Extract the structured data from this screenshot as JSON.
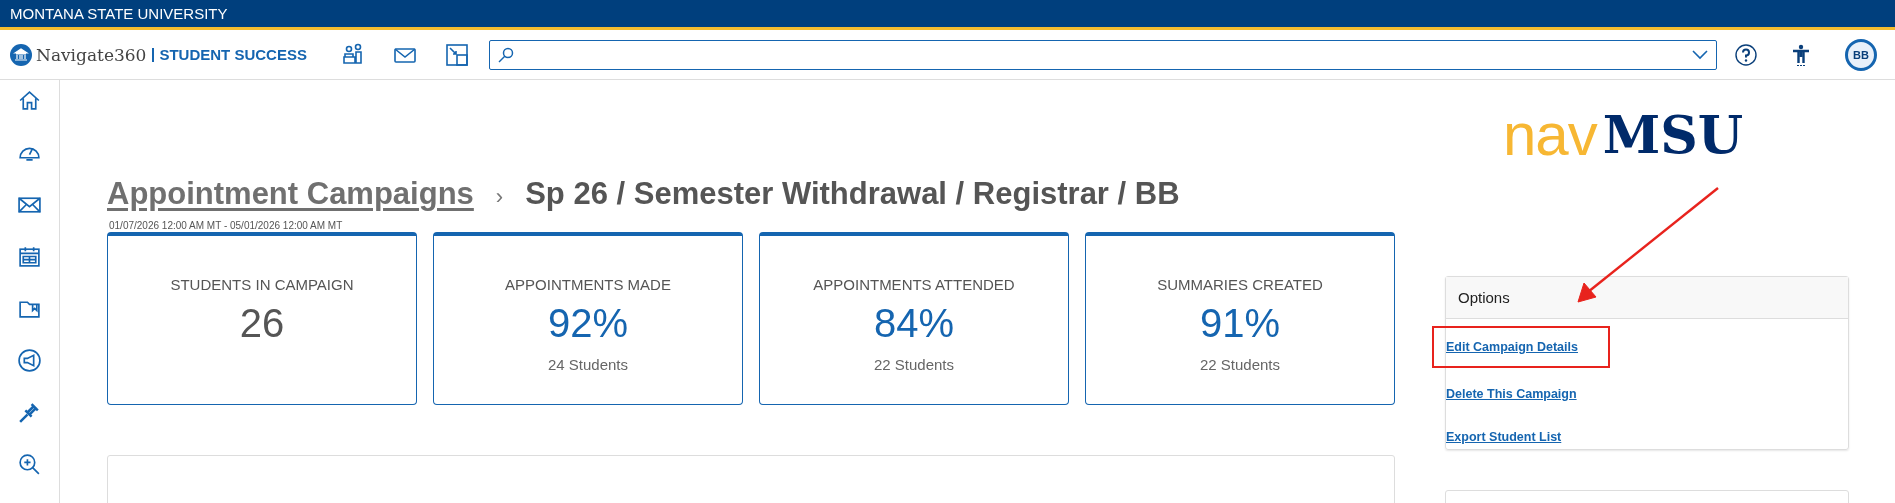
{
  "top_bar": {
    "title": "MONTANA STATE UNIVERSITY"
  },
  "header": {
    "brand": "Navigate360",
    "product": "STUDENT SUCCESS",
    "avatar": "BB"
  },
  "logo": {
    "part_1": "nav",
    "part_2": "MSU"
  },
  "page": {
    "breadcrumb": "Appointment Campaigns",
    "separator": "›",
    "title": "Sp 26 / Semester Withdrawal / Registrar / BB",
    "date_range": "01/07/2026 12:00 AM MT - 05/01/2026 12:00 AM MT"
  },
  "stats": [
    {
      "kind": "count",
      "label": "STUDENTS IN CAMPAIGN",
      "value": "26"
    },
    {
      "kind": "percent",
      "label": "APPOINTMENTS MADE",
      "value": "92%",
      "sub": "24 Students"
    },
    {
      "kind": "percent",
      "label": "APPOINTMENTS ATTENDED",
      "value": "84%",
      "sub": "22 Students"
    },
    {
      "kind": "percent",
      "label": "SUMMARIES CREATED",
      "value": "91%",
      "sub": "22 Students"
    }
  ],
  "options": {
    "title": "Options",
    "links": [
      {
        "label": "Edit Campaign Details",
        "highlighted": true
      },
      {
        "label": "Delete This Campaign",
        "highlighted": false
      },
      {
        "label": "Export Student List",
        "highlighted": false
      }
    ]
  }
}
